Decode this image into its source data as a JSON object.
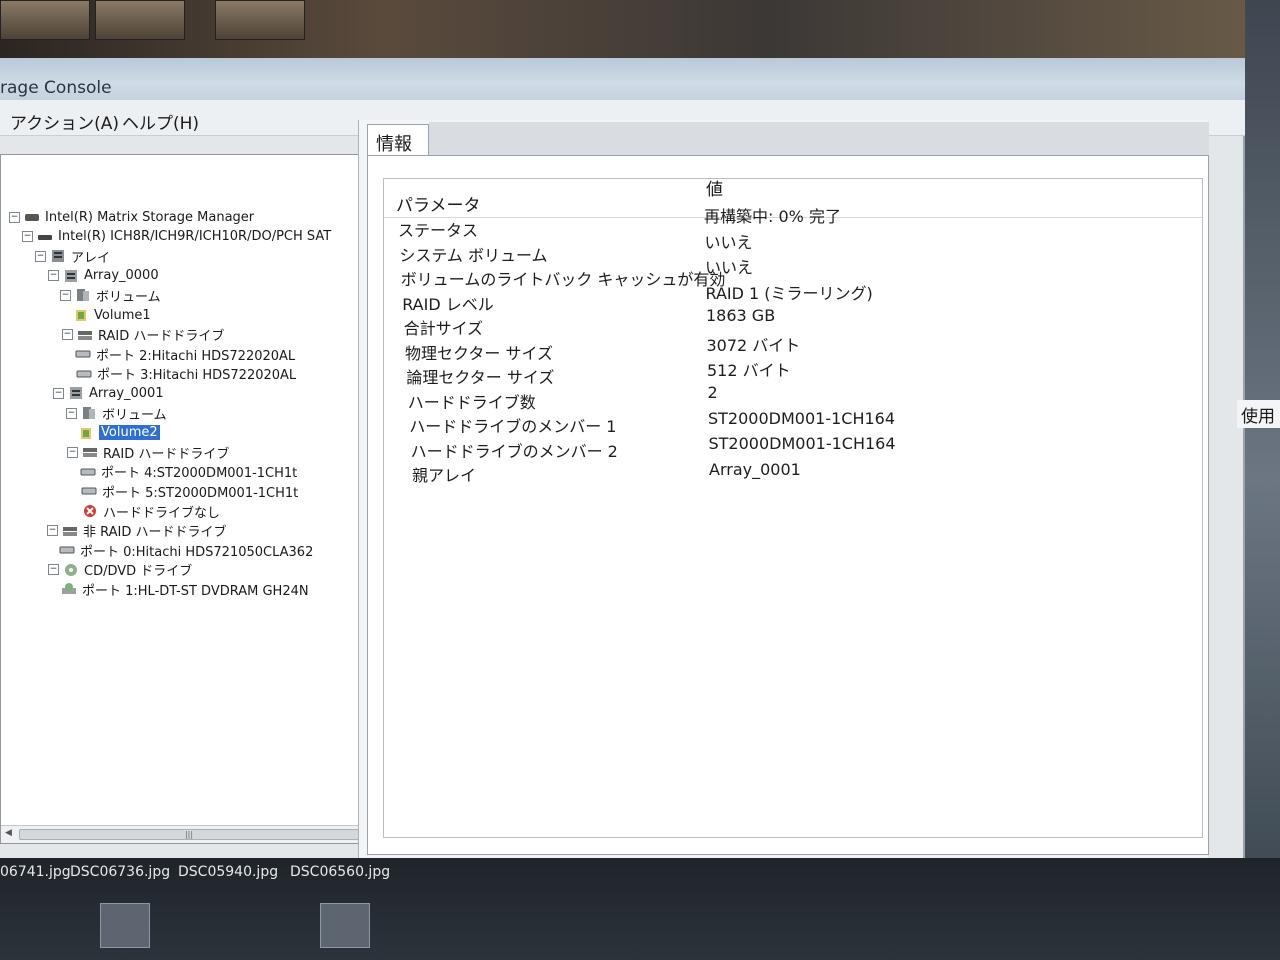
{
  "window": {
    "title": "rage Console"
  },
  "menu": {
    "items": [
      {
        "label": "アクション(A)"
      },
      {
        "label": "ヘルプ(H)"
      }
    ]
  },
  "tree": {
    "items": [
      {
        "label": "Intel(R) Matrix Storage Manager",
        "icon": "computer-icon",
        "depth": 0
      },
      {
        "label": "Intel(R) ICH8R/ICH9R/ICH10R/DO/PCH SAT",
        "icon": "controller-icon",
        "depth": 1
      },
      {
        "label": "アレイ",
        "icon": "array-group-icon",
        "depth": 2
      },
      {
        "label": "Array_0000",
        "icon": "array-icon",
        "depth": 3
      },
      {
        "label": "ボリューム",
        "icon": "volume-group-icon",
        "depth": 4
      },
      {
        "label": "Volume1",
        "icon": "volume-icon",
        "depth": 5
      },
      {
        "label": "RAID ハードドライブ",
        "icon": "raid-drives-icon",
        "depth": 4
      },
      {
        "label": "ポート 2:Hitachi HDS722020AL",
        "icon": "hard-drive-icon",
        "depth": 5
      },
      {
        "label": "ポート 3:Hitachi HDS722020AL",
        "icon": "hard-drive-icon",
        "depth": 5
      },
      {
        "label": "Array_0001",
        "icon": "array-icon",
        "depth": 3
      },
      {
        "label": "ボリューム",
        "icon": "volume-group-icon",
        "depth": 4
      },
      {
        "label": "Volume2",
        "icon": "volume-icon",
        "depth": 5,
        "selected": true
      },
      {
        "label": "RAID ハードドライブ",
        "icon": "raid-drives-icon",
        "depth": 4
      },
      {
        "label": "ポート 4:ST2000DM001-1CH1t",
        "icon": "hard-drive-icon",
        "depth": 5
      },
      {
        "label": "ポート 5:ST2000DM001-1CH1t",
        "icon": "hard-drive-icon",
        "depth": 5
      },
      {
        "label": "ハードドライブなし",
        "icon": "missing-drive-icon",
        "depth": 5
      },
      {
        "label": "非 RAID ハードドライブ",
        "icon": "raid-drives-icon",
        "depth": 2
      },
      {
        "label": "ポート 0:Hitachi HDS721050CLA362",
        "icon": "hard-drive-icon",
        "depth": 3
      },
      {
        "label": "CD/DVD ドライブ",
        "icon": "optical-group-icon",
        "depth": 2
      },
      {
        "label": "ポート 1:HL-DT-ST DVDRAM GH24N",
        "icon": "optical-drive-icon",
        "depth": 3
      }
    ]
  },
  "info": {
    "tab_label": "情報",
    "header_param": "パラメータ",
    "header_value": "値",
    "rows": [
      {
        "param": "ステータス",
        "value": "再構築中: 0% 完了"
      },
      {
        "param": "システム ボリューム",
        "value": "いいえ"
      },
      {
        "param": "ボリュームのライトバック キャッシュが有効",
        "value": "いいえ"
      },
      {
        "param": "RAID レベル",
        "value": "RAID 1 (ミラーリング)"
      },
      {
        "param": "合計サイズ",
        "value": "1863 GB"
      },
      {
        "param": "物理セクター サイズ",
        "value": "3072 バイト"
      },
      {
        "param": "論理セクター サイズ",
        "value": "512 バイト"
      },
      {
        "param": "ハードドライブ数",
        "value": "2"
      },
      {
        "param": "ハードドライブのメンバー 1",
        "value": "ST2000DM001-1CH164"
      },
      {
        "param": "ハードドライブのメンバー 2",
        "value": "ST2000DM001-1CH164"
      },
      {
        "param": "親アレイ",
        "value": "Array_0001"
      }
    ]
  },
  "desktop": {
    "files": [
      "06741.jpg",
      "DSC06736.jpg",
      "DSC05940.jpg",
      "DSC06560.jpg"
    ],
    "side_note": "使用"
  }
}
